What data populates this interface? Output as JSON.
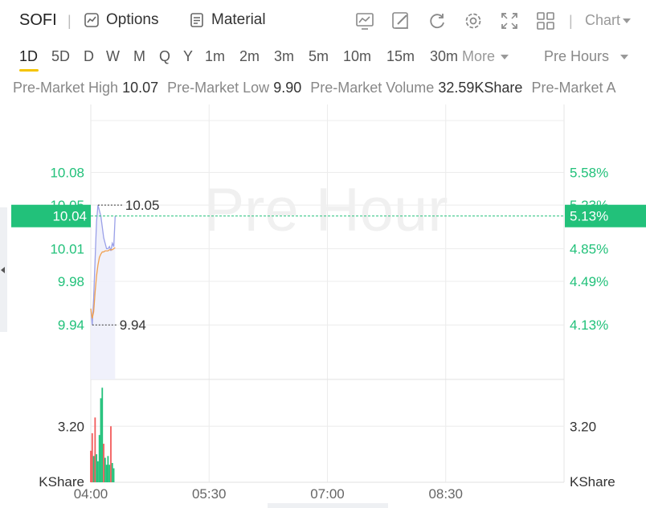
{
  "header": {
    "ticker": "SOFI",
    "options_label": "Options",
    "material_label": "Material",
    "chart_select_label": "Chart",
    "tools": [
      "trend-chart-icon",
      "draw-pencil-icon",
      "refresh-icon",
      "settings-gear-icon",
      "fullscreen-icon",
      "grid-layout-icon"
    ]
  },
  "periods": [
    "1D",
    "5D",
    "D",
    "W",
    "M",
    "Q",
    "Y",
    "1m",
    "2m",
    "3m",
    "5m",
    "10m",
    "15m",
    "30m"
  ],
  "active_period": "1D",
  "more_label": "More",
  "session_label": "Pre Hours",
  "stats": [
    {
      "label": "Pre-Market High",
      "value": "10.07"
    },
    {
      "label": "Pre-Market Low",
      "value": "9.90"
    },
    {
      "label": "Pre-Market Volume",
      "value": "32.59KShare"
    },
    {
      "label": "Pre-Market A",
      "value": ""
    }
  ],
  "colors": {
    "up": "#22c17a",
    "down": "#f25b5b",
    "accent": "#f5c400",
    "price_line": "#9aa0e8",
    "avg_line": "#f0a050"
  },
  "chart_data": {
    "type": "line",
    "watermark": "Pre Hour",
    "x_ticks": [
      "04:00",
      "05:30",
      "07:00",
      "08:30"
    ],
    "x_range_minutes": [
      240,
      570
    ],
    "price": {
      "ylim": [
        9.89,
        10.135
      ],
      "y_ticks_left": [
        "10.08",
        "10.05",
        "10.01",
        "9.98",
        "9.94"
      ],
      "y_tick_values": [
        10.08,
        10.05,
        10.01,
        9.98,
        9.94
      ],
      "y_ticks_right": [
        "5.58%",
        "5.23%",
        "4.85%",
        "4.49%",
        "4.13%"
      ],
      "current_price": "10.04",
      "current_price_value": 10.04,
      "current_change": "5.13%",
      "high_label": "10.05",
      "high_value": 10.05,
      "low_label": "9.94",
      "low_value": 9.94,
      "series": [
        {
          "x": [
            240,
            241,
            242,
            243,
            244,
            245,
            246,
            247,
            248,
            249,
            250,
            251,
            252,
            253,
            254,
            255,
            256,
            257
          ],
          "values": [
            9.955,
            9.94,
            9.965,
            10.0,
            10.035,
            10.05,
            10.045,
            10.04,
            10.03,
            10.02,
            10.015,
            10.01,
            10.01,
            10.012,
            10.008,
            10.015,
            10.012,
            10.04
          ]
        },
        {
          "x": [
            240,
            241,
            242,
            243,
            244,
            245,
            246,
            247,
            248,
            249,
            250,
            251,
            252,
            253,
            254,
            255,
            256,
            257
          ],
          "values": [
            9.955,
            9.946,
            9.952,
            9.97,
            9.985,
            9.995,
            10.002,
            10.005,
            10.007,
            10.007,
            10.008,
            10.008,
            10.008,
            10.009,
            10.009,
            10.009,
            10.01,
            10.011
          ]
        }
      ]
    },
    "volume": {
      "unit": "KShare",
      "tick_label": "3.20",
      "tick_value": 3.2,
      "ymax": 5.6,
      "bars": [
        {
          "x": 240,
          "v": 1.8,
          "dir": "down"
        },
        {
          "x": 241,
          "v": 2.8,
          "dir": "down"
        },
        {
          "x": 242,
          "v": 1.5,
          "dir": "up"
        },
        {
          "x": 243,
          "v": 3.7,
          "dir": "down"
        },
        {
          "x": 244,
          "v": 1.6,
          "dir": "up"
        },
        {
          "x": 245,
          "v": 1.2,
          "dir": "up"
        },
        {
          "x": 246,
          "v": 2.7,
          "dir": "up"
        },
        {
          "x": 247,
          "v": 4.8,
          "dir": "up"
        },
        {
          "x": 248,
          "v": 5.4,
          "dir": "up"
        },
        {
          "x": 249,
          "v": 2.2,
          "dir": "down"
        },
        {
          "x": 250,
          "v": 1.4,
          "dir": "up"
        },
        {
          "x": 251,
          "v": 1.0,
          "dir": "up"
        },
        {
          "x": 252,
          "v": 1.5,
          "dir": "up"
        },
        {
          "x": 253,
          "v": 1.0,
          "dir": "up"
        },
        {
          "x": 254,
          "v": 3.2,
          "dir": "down"
        },
        {
          "x": 255,
          "v": 1.1,
          "dir": "up"
        },
        {
          "x": 256,
          "v": 0.8,
          "dir": "up"
        }
      ]
    }
  }
}
